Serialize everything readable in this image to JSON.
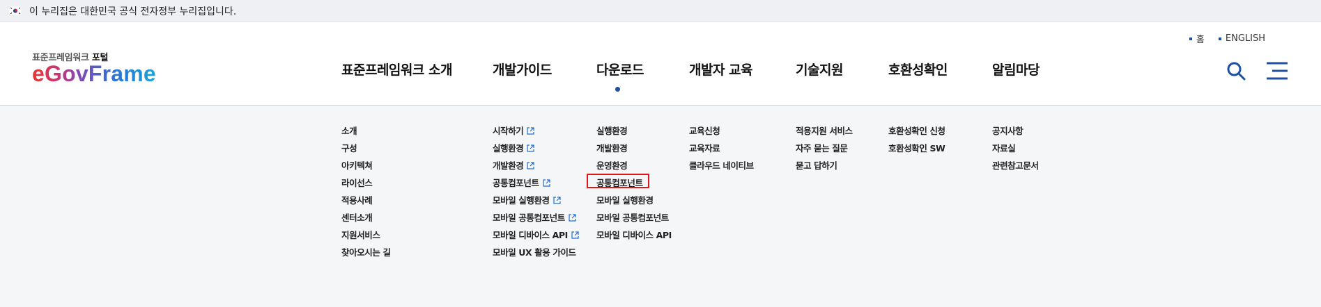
{
  "gov_banner": {
    "text": "이 누리집은 대한민국 공식 전자정부 누리집입니다."
  },
  "util_links": [
    "홈",
    "ENGLISH"
  ],
  "logo": {
    "sub": "표준프레임워크",
    "sub_bold": "포털",
    "main": "eGovFrame"
  },
  "gnb": [
    "표준프레임워크 소개",
    "개발가이드",
    "다운로드",
    "개발자 교육",
    "기술지원",
    "호환성확인",
    "알림마당"
  ],
  "gnb_active": "다운로드",
  "submenu": {
    "col1": [
      "소개",
      "구성",
      "아키텍쳐",
      "라이선스",
      "적용사례",
      "센터소개",
      "지원서비스",
      "찾아오시는 길"
    ],
    "col2": [
      "시작하기",
      "실행환경",
      "개발환경",
      "공통컴포넌트",
      "모바일 실행환경",
      "모바일 공통컴포넌트",
      "모바일 디바이스 API",
      "모바일 UX 활용 가이드"
    ],
    "col3": [
      "실행환경",
      "개발환경",
      "운영환경",
      "공통컴포넌트",
      "모바일 실행환경",
      "모바일 공통컴포넌트",
      "모바일 디바이스 API"
    ],
    "col4": [
      "교육신청",
      "교육자료",
      "클라우드 네이티브"
    ],
    "col5": [
      "적용지원 서비스",
      "자주 묻는 질문",
      "묻고 답하기"
    ],
    "col6": [
      "호환성확인 신청",
      "호환성확인 SW"
    ],
    "col7": [
      "공지사항",
      "자료실",
      "관련참고문서"
    ]
  },
  "colors": {
    "accent": "#1e4fa3",
    "highlight": "#e0171b"
  },
  "icons": [
    "flag-icon",
    "search-icon",
    "menu-icon",
    "external-link-icon"
  ]
}
